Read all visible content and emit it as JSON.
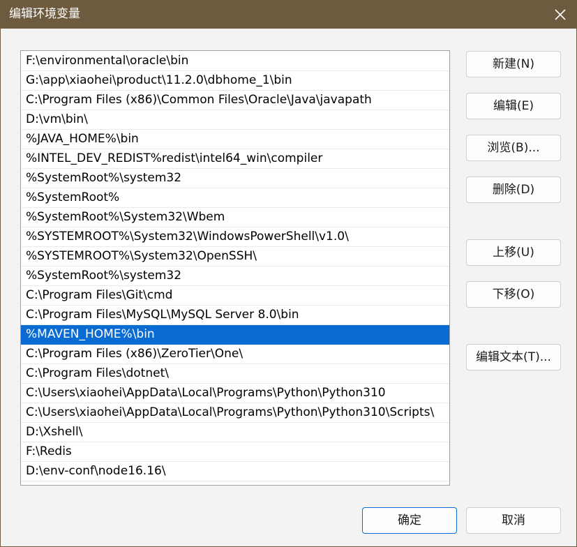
{
  "window": {
    "title": "编辑环境变量"
  },
  "list": {
    "items": [
      "F:\\environmental\\oracle\\bin",
      "G:\\app\\xiaohei\\product\\11.2.0\\dbhome_1\\bin",
      "C:\\Program Files (x86)\\Common Files\\Oracle\\Java\\javapath",
      "D:\\vm\\bin\\",
      "%JAVA_HOME%\\bin",
      "%INTEL_DEV_REDIST%redist\\intel64_win\\compiler",
      "%SystemRoot%\\system32",
      "%SystemRoot%",
      "%SystemRoot%\\System32\\Wbem",
      "%SYSTEMROOT%\\System32\\WindowsPowerShell\\v1.0\\",
      "%SYSTEMROOT%\\System32\\OpenSSH\\",
      "%SystemRoot%\\system32",
      "C:\\Program Files\\Git\\cmd",
      "C:\\Program Files\\MySQL\\MySQL Server 8.0\\bin",
      "%MAVEN_HOME%\\bin",
      "C:\\Program Files (x86)\\ZeroTier\\One\\",
      "C:\\Program Files\\dotnet\\",
      "C:\\Users\\xiaohei\\AppData\\Local\\Programs\\Python\\Python310",
      "C:\\Users\\xiaohei\\AppData\\Local\\Programs\\Python\\Python310\\Scripts\\",
      "D:\\Xshell\\",
      "F:\\Redis",
      "D:\\env-conf\\node16.16\\"
    ],
    "selected_index": 14
  },
  "buttons": {
    "new": "新建(N)",
    "edit": "编辑(E)",
    "browse": "浏览(B)...",
    "delete": "删除(D)",
    "move_up": "上移(U)",
    "move_down": "下移(O)",
    "edit_text": "编辑文本(T)...",
    "ok": "确定",
    "cancel": "取消"
  },
  "icons": {
    "close": "close-icon"
  },
  "colors": {
    "titlebar": "#6e5a3e",
    "selection": "#0a6cd2"
  }
}
